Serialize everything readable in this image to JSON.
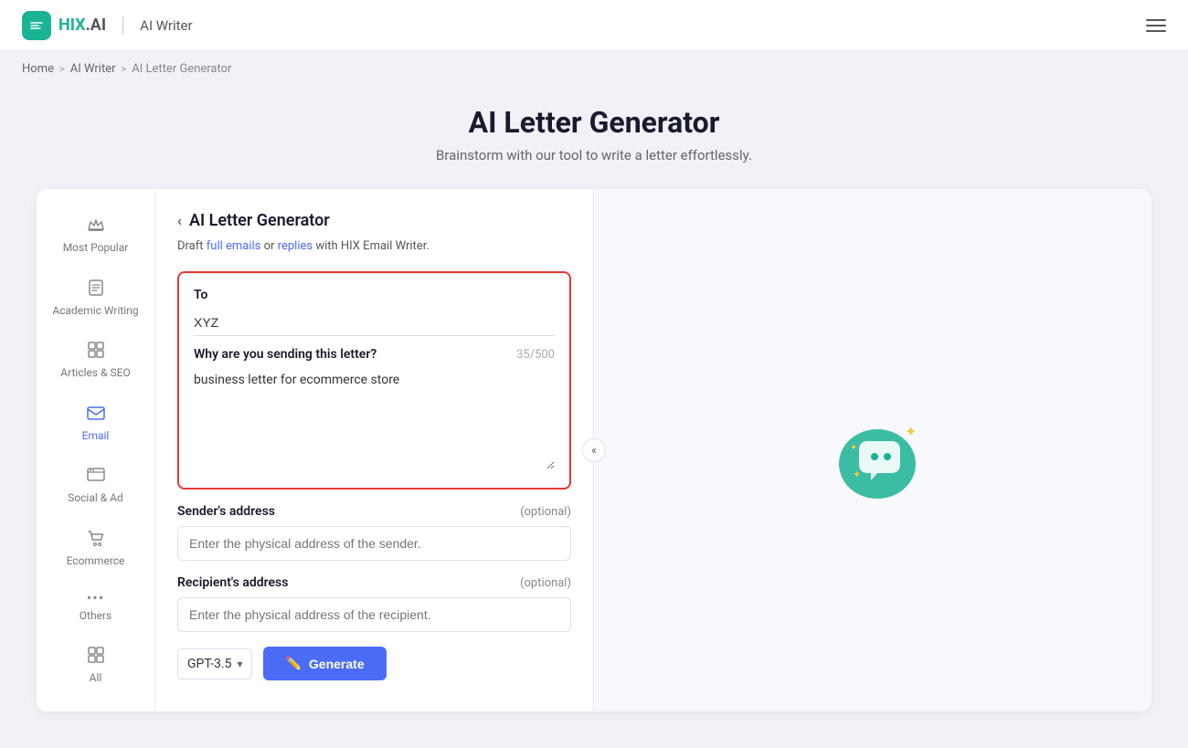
{
  "header": {
    "logo_text": "HIX.AI",
    "logo_icon": "💬",
    "divider": "|",
    "app_name": "AI Writer"
  },
  "breadcrumb": {
    "home": "Home",
    "ai_writer": "AI Writer",
    "current": "AI Letter Generator",
    "sep": ">"
  },
  "page": {
    "title": "AI Letter Generator",
    "subtitle": "Brainstorm with our tool to write a letter effortlessly."
  },
  "sidebar": {
    "items": [
      {
        "id": "most-popular",
        "label": "Most Popular",
        "icon": "👑"
      },
      {
        "id": "academic-writing",
        "label": "Academic Writing",
        "icon": "📄"
      },
      {
        "id": "articles-seo",
        "label": "Articles & SEO",
        "icon": "📋"
      },
      {
        "id": "email",
        "label": "Email",
        "icon": "✉️",
        "active": true
      },
      {
        "id": "social-ad",
        "label": "Social & Ad",
        "icon": "🖥"
      },
      {
        "id": "ecommerce",
        "label": "Ecommerce",
        "icon": "🛒"
      },
      {
        "id": "others",
        "label": "Others",
        "icon": "•••"
      },
      {
        "id": "all",
        "label": "All",
        "icon": "⊞"
      }
    ]
  },
  "form": {
    "title": "AI Letter Generator",
    "back_arrow": "‹",
    "hint_text": "Draft ",
    "full_emails_link": "full emails",
    "hint_or": " or ",
    "replies_link": "replies",
    "hint_end": " with HIX Email Writer.",
    "to_label": "To",
    "to_value": "XYZ",
    "to_placeholder": "",
    "why_label": "Why are you sending this letter?",
    "why_counter": "35/500",
    "why_value": "business letter for ecommerce store",
    "sender_label": "Sender's address",
    "sender_optional": "(optional)",
    "sender_placeholder": "Enter the physical address of the sender.",
    "recipient_label": "Recipient's address",
    "recipient_optional": "(optional)",
    "recipient_placeholder": "Enter the physical address of the recipient.",
    "model_label": "GPT-3.5",
    "generate_label": "Generate",
    "generate_icon": "✏️",
    "collapse_icon": "«"
  }
}
